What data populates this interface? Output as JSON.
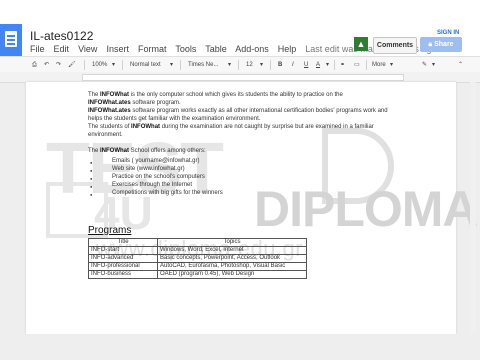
{
  "header": {
    "title": "IL-ates0122",
    "menu": [
      "File",
      "Edit",
      "View",
      "Insert",
      "Format",
      "Tools",
      "Table",
      "Add-ons",
      "Help"
    ],
    "last_edit": "Last edit was made seconds ago",
    "comments_label": "Comments",
    "share_label": "Share",
    "signin_label": "SIGN IN"
  },
  "toolbar": {
    "zoom": "100%",
    "style": "Normal text",
    "font": "Times Ne...",
    "size": "12",
    "bold": "B",
    "italic": "I",
    "underline": "U",
    "text_color": "A",
    "more": "More"
  },
  "document": {
    "paragraphs": [
      [
        "The ",
        "INFOWhat",
        " is the only computer school which gives its students the ability to practice on the "
      ],
      [
        "INFOWhat.ates",
        " software program."
      ],
      [
        "INFOWhat.ates",
        " software program works exactly as all other international certification bodies' programs work and helps the students get familiar with the examination environment."
      ],
      [
        "The students of ",
        "INFOWhat",
        " during the examination are not caught by surprise but are examined in a familiar environment."
      ]
    ],
    "offer_intro": [
      "The ",
      "INFOWhat",
      " School offers among others:"
    ],
    "bullets": [
      "Emails ( yourname@infowhat.gr)",
      "Web site (www.infowhat.gr)",
      "Practice on the school's computers",
      "Exercises through the Internet",
      "Competitions with big gifts for the winners"
    ],
    "heading": "Programs",
    "table": {
      "headers": [
        "Title",
        "Topics"
      ],
      "rows": [
        [
          "INFO-start",
          "Windows, Word, Excel, Internet"
        ],
        [
          "INFO-advanced",
          "Basic concepts, Powerpoint, Access, Outlook"
        ],
        [
          "INFO-professional",
          "AutoCAD, Eurofasma, Photoshop, Visual Basic"
        ],
        [
          "INFO-business",
          "OAED (program 0.45), Web Design"
        ]
      ]
    }
  },
  "watermark": {
    "brand_left": "TEST",
    "brand_num": "4U",
    "brand_right": "DIPLOMA",
    "url": "www.diploma.edu.gr"
  },
  "colors": {
    "docs_blue": "#4285f4",
    "share_button": "#9fbef0",
    "notification_green": "#2e7d32"
  }
}
